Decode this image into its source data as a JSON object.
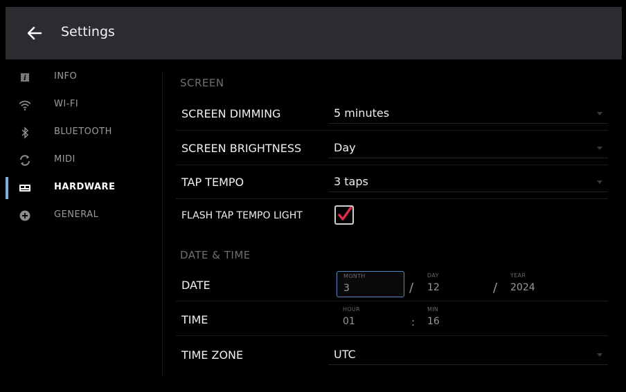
{
  "header": {
    "title": "Settings",
    "back_icon": "arrow-left-icon"
  },
  "sidebar": {
    "items": [
      {
        "label": "INFO",
        "icon": "info-icon",
        "active": false
      },
      {
        "label": "WI-FI",
        "icon": "wifi-icon",
        "active": false
      },
      {
        "label": "BLUETOOTH",
        "icon": "bluetooth-icon",
        "active": false
      },
      {
        "label": "MIDI",
        "icon": "sync-icon",
        "active": false
      },
      {
        "label": "HARDWARE",
        "icon": "hardware-icon",
        "active": true
      },
      {
        "label": "GENERAL",
        "icon": "plus-circle-icon",
        "active": false
      }
    ],
    "active_color": "#7ab0e0"
  },
  "screen": {
    "section_title": "SCREEN",
    "dimming": {
      "label": "SCREEN DIMMING",
      "value": "5 minutes"
    },
    "brightness": {
      "label": "SCREEN BRIGHTNESS",
      "value": "Day"
    },
    "tap_tempo": {
      "label": "TAP TEMPO",
      "value": "3 taps"
    },
    "flash": {
      "label": "FLASH TAP TEMPO LIGHT",
      "checked": true,
      "check_color": "#e02a4a"
    }
  },
  "datetime": {
    "section_title": "DATE & TIME",
    "date": {
      "label": "DATE",
      "month_caption": "MONTH",
      "month": "3",
      "day_caption": "DAY",
      "day": "12",
      "year_caption": "YEAR",
      "year": "2024",
      "separator": "/"
    },
    "time": {
      "label": "TIME",
      "hour_caption": "HOUR",
      "hour": "01",
      "min_caption": "MIN",
      "min": "16",
      "separator": ":"
    },
    "timezone": {
      "label": "TIME ZONE",
      "value": "UTC"
    }
  }
}
